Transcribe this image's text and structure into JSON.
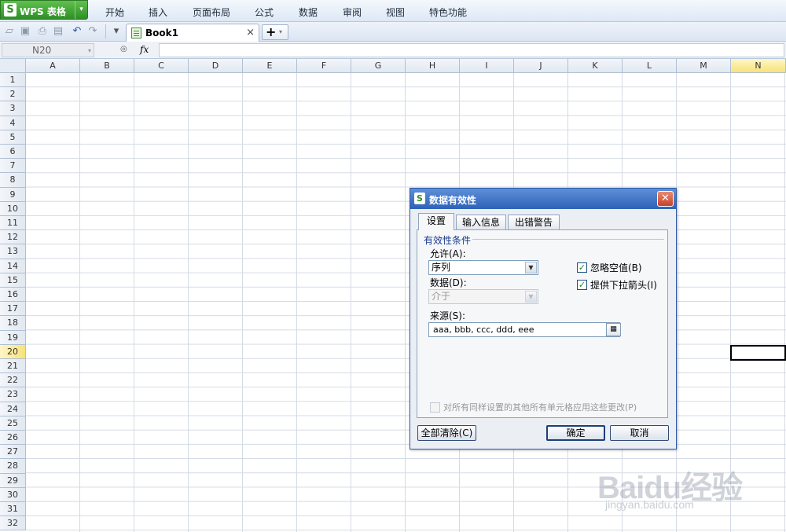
{
  "app": {
    "brand_label": "WPS 表格",
    "menus": [
      "开始",
      "插入",
      "页面布局",
      "公式",
      "数据",
      "审阅",
      "视图",
      "特色功能"
    ]
  },
  "toolbar": {
    "tab_name": "Book1",
    "close_glyph": "×",
    "new_tab_glyph": "+"
  },
  "formula_bar": {
    "name_box": "N20",
    "fx_label": "fx",
    "formula": ""
  },
  "sheet": {
    "columns": [
      "A",
      "B",
      "C",
      "D",
      "E",
      "F",
      "G",
      "H",
      "I",
      "J",
      "K",
      "L",
      "M",
      "N"
    ],
    "rows": [
      "1",
      "2",
      "3",
      "4",
      "5",
      "6",
      "7",
      "8",
      "9",
      "10",
      "11",
      "12",
      "13",
      "14",
      "15",
      "16",
      "17",
      "18",
      "19",
      "20",
      "21",
      "22",
      "23",
      "24",
      "25",
      "26",
      "27",
      "28",
      "29",
      "30",
      "31",
      "32"
    ],
    "selected_column": "N",
    "selected_row": "20"
  },
  "dialog": {
    "title": "数据有效性",
    "tabs": [
      "设置",
      "输入信息",
      "出错警告"
    ],
    "active_tab": "设置",
    "group_title": "有效性条件",
    "allow_label": "允许(A):",
    "allow_value": "序列",
    "data_label": "数据(D):",
    "data_value": "介于",
    "ignore_blank_label": "忽略空值(B)",
    "ignore_blank_checked": true,
    "dropdown_label": "提供下拉箭头(I)",
    "dropdown_checked": true,
    "source_label": "来源(S):",
    "source_value": "aaa, bbb, ccc, ddd, eee",
    "apply_all_label": "对所有同样设置的其他所有单元格应用这些更改(P)",
    "apply_all_checked": false,
    "clear_all_label": "全部清除(C)",
    "ok_label": "确定",
    "cancel_label": "取消"
  },
  "watermark": {
    "brand": "Baidu经验",
    "url": "jingyan.baidu.com"
  }
}
